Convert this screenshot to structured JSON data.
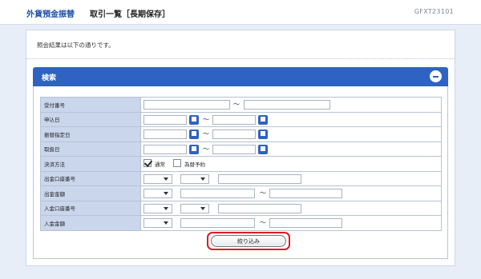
{
  "header": {
    "brand": "外貨預金振替",
    "title": "取引一覧［長期保存］",
    "screen_code": "GFXT23101"
  },
  "message": "照会結果は以下の通りです。",
  "search_panel": {
    "title": "検索",
    "rows": {
      "receipt_number": "受付番号",
      "application_date": "申込日",
      "transfer_date": "振替指定日",
      "handling_date": "取扱日",
      "settlement_method": "決済方法",
      "debit_account": "出金口座番号",
      "debit_amount": "出金金額",
      "credit_account": "入金口座番号",
      "credit_amount": "入金金額"
    },
    "range_separator": "～",
    "settlement_options": [
      {
        "label": "通常",
        "checked": true
      },
      {
        "label": "為替予約",
        "checked": false
      }
    ],
    "filter_button": "絞り込み"
  },
  "colors": {
    "brand_blue": "#1f4fa8",
    "panel_blue": "#2f63c2",
    "label_bg": "#c9d6ec",
    "highlight_red": "#e01b23"
  },
  "icons": [
    "collapse-minus-icon",
    "calendar-icon",
    "checkbox-checked-icon",
    "dropdown-arrow-icon"
  ]
}
